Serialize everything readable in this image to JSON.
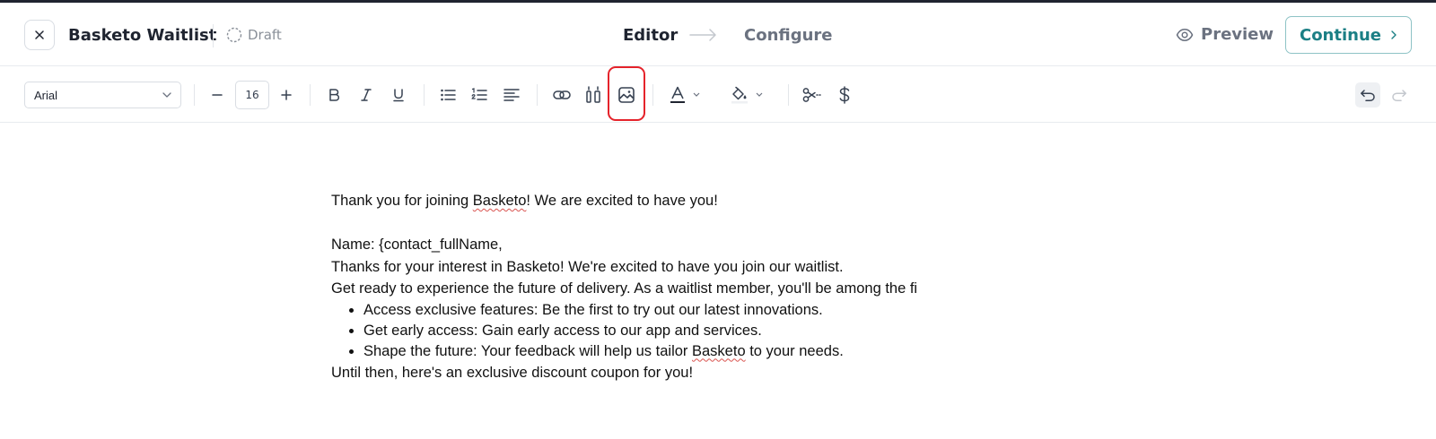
{
  "header": {
    "title": "Basketo Waitlist",
    "status": "Draft",
    "steps": [
      {
        "label": "Editor",
        "active": true
      },
      {
        "label": "Configure",
        "active": false
      }
    ],
    "preview_label": "Preview",
    "continue_label": "Continue"
  },
  "toolbar": {
    "font_family_value": "Arial",
    "font_size_value": "16",
    "icons": [
      "minus-icon",
      "plus-icon",
      "bold-icon",
      "italic-icon",
      "underline-icon",
      "bullet-list-icon",
      "numbered-list-icon",
      "align-left-icon",
      "link-icon",
      "columns-icon",
      "image-icon",
      "text-color-icon",
      "fill-color-icon",
      "scissors-icon",
      "dollar-icon",
      "undo-icon",
      "redo-icon"
    ],
    "highlighted_tool": "image-icon"
  },
  "content": {
    "intro_before": "Thank you for joining ",
    "intro_brand": "Basketo",
    "intro_after": "! We are excited to have you!",
    "name_line": "Name: {contact_fullName,",
    "thanks_line": "Thanks for your interest in Basketo! We're excited to have you join our waitlist.",
    "ready_line": "Get ready to experience the future of delivery. As a waitlist member, you'll be among the fi",
    "bullets": [
      "Access exclusive features: Be the first to try out our latest innovations.",
      "Get early access: Gain early access to our app and services."
    ],
    "bullet3_before": "Shape the future: Your feedback will help us tailor ",
    "bullet3_brand": "Basketo",
    "bullet3_after": " to your needs.",
    "closing_line": "Until then, here's an exclusive discount coupon for you!"
  },
  "colors": {
    "accent": "#1b7f85",
    "accent_border": "#8ec3c6",
    "highlight": "#e5232b",
    "text_dark": "#1f2430",
    "text_muted": "#6b7280"
  }
}
